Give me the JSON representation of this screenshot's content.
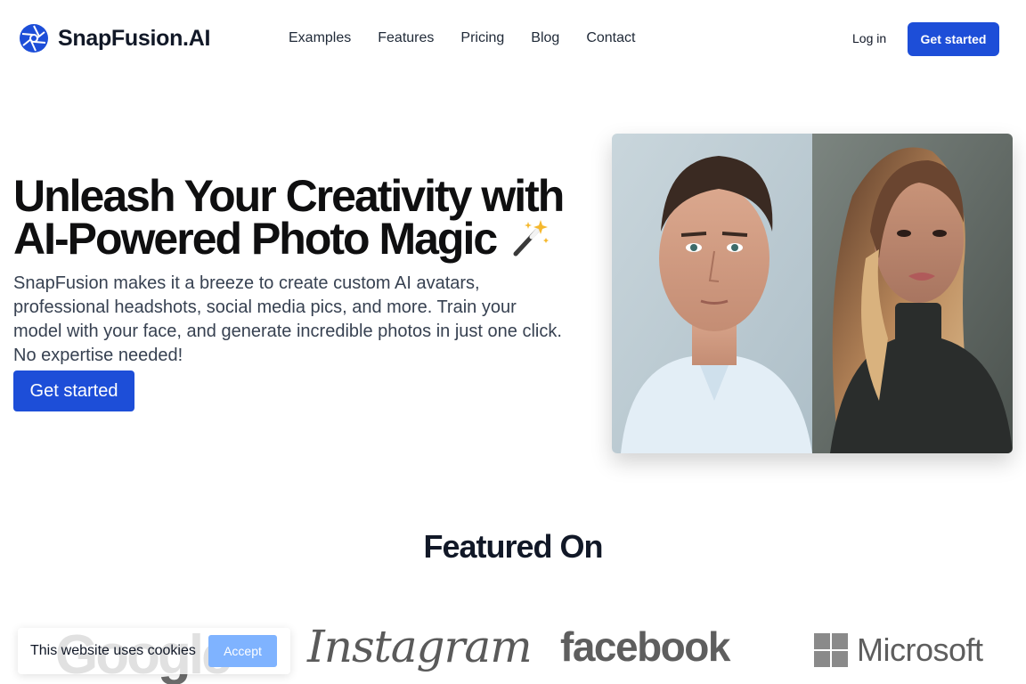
{
  "header": {
    "brand_name": "SnapFusion.AI",
    "brand_icon": "aperture-icon",
    "nav": [
      "Examples",
      "Features",
      "Pricing",
      "Blog",
      "Contact"
    ],
    "login_label": "Log in",
    "cta_label": "Get started"
  },
  "hero": {
    "title_line1": "Unleash Your Creativity with",
    "title_line2": "AI-Powered Photo Magic",
    "title_icon": "magic-wand-icon",
    "subtitle": "SnapFusion makes it a breeze to create custom AI avatars, professional headshots, social media pics, and more. Train your model with your face, and generate incredible photos in just one click. No expertise needed!",
    "cta_label": "Get started"
  },
  "featured": {
    "title": "Featured On",
    "logos": [
      "Google",
      "Instagram",
      "facebook",
      "Microsoft"
    ]
  },
  "cookie": {
    "text": "This website uses cookies",
    "accept_label": "Accept"
  },
  "colors": {
    "primary": "#1d4ed8",
    "accept_button": "#7fb3ff",
    "text_dark": "#111827"
  }
}
